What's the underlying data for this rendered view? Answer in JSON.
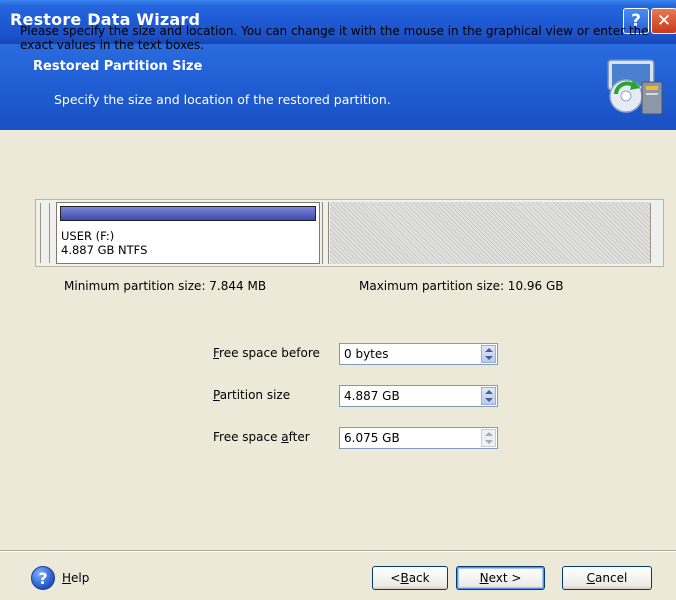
{
  "window": {
    "title": "Restore Data Wizard",
    "title_buttons": {
      "help": "?",
      "close": "✕"
    }
  },
  "header": {
    "title": "Restored Partition Size",
    "subtitle": "Specify the size and location of the restored partition.",
    "icon": "restore-wizard-icon"
  },
  "content": {
    "description": "Please specify the size and location. You can change it with the mouse in the graphical view or enter the exact values in the text boxes.",
    "partition": {
      "name": "USER (F:)",
      "info": "4.887 GB  NTFS"
    },
    "min_size": "Minimum partition size:  7.844 MB",
    "max_size": "Maximum partition size:  10.96 GB",
    "fields": {
      "free_before": {
        "label_hot": "F",
        "label_rest": "ree space before",
        "value": "0 bytes"
      },
      "partition_size": {
        "label_hot": "P",
        "label_rest": "artition size",
        "value": "4.887 GB"
      },
      "free_after": {
        "label_pre": "Free space ",
        "label_hot": "a",
        "label_rest": "fter",
        "value": "6.075 GB"
      }
    }
  },
  "footer": {
    "help": {
      "hot": "H",
      "rest": "elp"
    },
    "back": {
      "pre": "< ",
      "hot": "B",
      "rest": "ack"
    },
    "next": {
      "hot": "N",
      "rest": "ext >"
    },
    "cancel": {
      "hot": "C",
      "rest": "ancel"
    }
  },
  "colors": {
    "title_bar": "#1f5bd6",
    "header": "#2163d9",
    "partition_bar": "#4a57b8",
    "dialog_bg": "#ece9d8"
  }
}
